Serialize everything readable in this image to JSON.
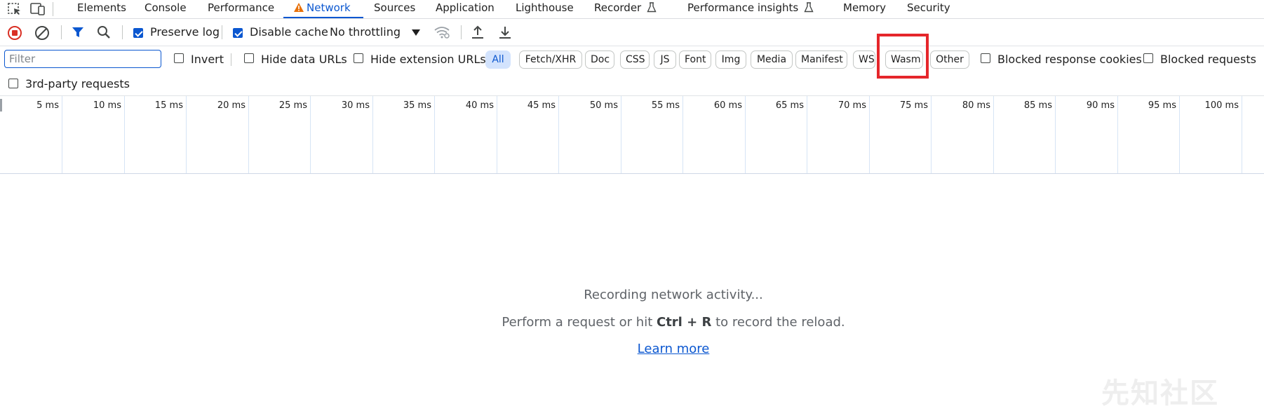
{
  "tabs": [
    {
      "label": "Elements"
    },
    {
      "label": "Console"
    },
    {
      "label": "Performance"
    },
    {
      "label": "Network",
      "active": true,
      "badge": "warning-icon"
    },
    {
      "label": "Sources"
    },
    {
      "label": "Application"
    },
    {
      "label": "Lighthouse"
    },
    {
      "label": "Recorder",
      "badge": "flask-icon"
    },
    {
      "label": "Performance insights",
      "badge": "flask-icon"
    },
    {
      "label": "Memory"
    },
    {
      "label": "Security"
    }
  ],
  "toolbar": {
    "preserve_log": {
      "label": "Preserve log",
      "checked": true
    },
    "disable_cache": {
      "label": "Disable cache",
      "checked": true
    },
    "throttling": "No throttling"
  },
  "filter": {
    "placeholder": "Filter",
    "value": "",
    "invert": {
      "label": "Invert",
      "checked": false
    },
    "hide_data_urls": {
      "label": "Hide data URLs",
      "checked": false
    },
    "hide_extension_urls": {
      "label": "Hide extension URLs",
      "checked": false
    },
    "types": [
      "All",
      "Fetch/XHR",
      "Doc",
      "CSS",
      "JS",
      "Font",
      "Img",
      "Media",
      "Manifest",
      "WS",
      "Wasm",
      "Other"
    ],
    "selected_type": "All",
    "blocked_response_cookies": {
      "label": "Blocked response cookies",
      "checked": false
    },
    "blocked_requests": {
      "label": "Blocked requests",
      "checked": false
    },
    "third_party": {
      "label": "3rd-party requests",
      "checked": false
    }
  },
  "timeline": {
    "ticks": [
      "5 ms",
      "10 ms",
      "15 ms",
      "20 ms",
      "25 ms",
      "30 ms",
      "35 ms",
      "40 ms",
      "45 ms",
      "50 ms",
      "55 ms",
      "60 ms",
      "65 ms",
      "70 ms",
      "75 ms",
      "80 ms",
      "85 ms",
      "90 ms",
      "95 ms",
      "100 ms"
    ]
  },
  "empty_state": {
    "recording": "Recording network activity...",
    "hint_before": "Perform a request or hit ",
    "hint_key1": "Ctrl",
    "hint_plus": " + ",
    "hint_key2": "R",
    "hint_after": " to record the reload.",
    "learn_more": "Learn more"
  },
  "watermark": "先知社区",
  "colors": {
    "accent": "#0b57d0",
    "highlight": "#e5262b",
    "warning": "#e8710a",
    "record": "#d93025"
  }
}
